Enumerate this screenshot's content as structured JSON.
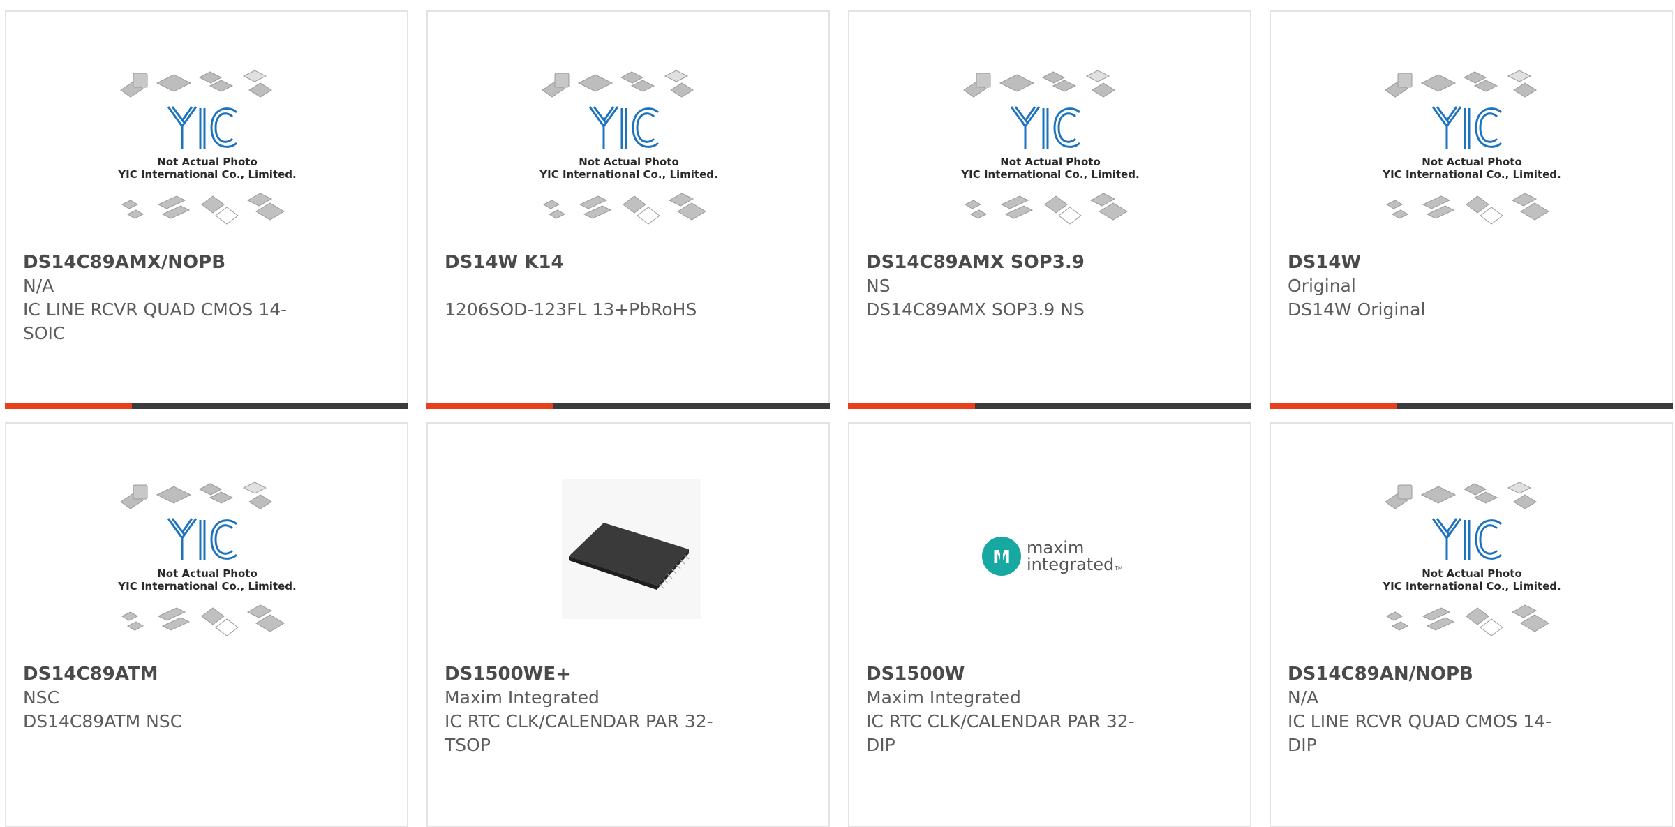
{
  "placeholder_photo": {
    "brand": "YIC",
    "caption_line1": "Not Actual Photo",
    "caption_line2": "YIC International Co., Limited."
  },
  "maxim_logo": {
    "line1": "maxim",
    "line2": "integrated"
  },
  "colors": {
    "accent": "#e8401c",
    "bar": "#3b3b3b",
    "border": "#e3e3e3",
    "yic_blue": "#1e73be",
    "maxim_teal": "#17a9a1"
  },
  "products": [
    {
      "part": "DS14C89AMX/NOPB",
      "maker": "N/A",
      "desc1": "IC LINE RCVR QUAD CMOS 14-",
      "desc2": "SOIC",
      "image": "placeholder"
    },
    {
      "part": "DS14W K14",
      "maker": "",
      "desc1": "1206SOD-123FL 13+PbRoHS",
      "desc2": "",
      "image": "placeholder"
    },
    {
      "part": "DS14C89AMX SOP3.9",
      "maker": "NS",
      "desc1": "DS14C89AMX SOP3.9 NS",
      "desc2": "",
      "image": "placeholder"
    },
    {
      "part": "DS14W",
      "maker": "Original",
      "desc1": "DS14W Original",
      "desc2": "",
      "image": "placeholder"
    },
    {
      "part": "DS14C89ATM",
      "maker": "NSC",
      "desc1": "DS14C89ATM NSC",
      "desc2": "",
      "image": "placeholder"
    },
    {
      "part": "DS1500WE+",
      "maker": "Maxim Integrated",
      "desc1": "IC RTC CLK/CALENDAR PAR 32-",
      "desc2": "TSOP",
      "image": "chip-photo"
    },
    {
      "part": "DS1500W",
      "maker": "Maxim Integrated",
      "desc1": "IC RTC CLK/CALENDAR PAR 32-",
      "desc2": "DIP",
      "image": "maxim-logo"
    },
    {
      "part": "DS14C89AN/NOPB",
      "maker": "N/A",
      "desc1": "IC LINE RCVR QUAD CMOS 14-",
      "desc2": "DIP",
      "image": "placeholder"
    }
  ]
}
